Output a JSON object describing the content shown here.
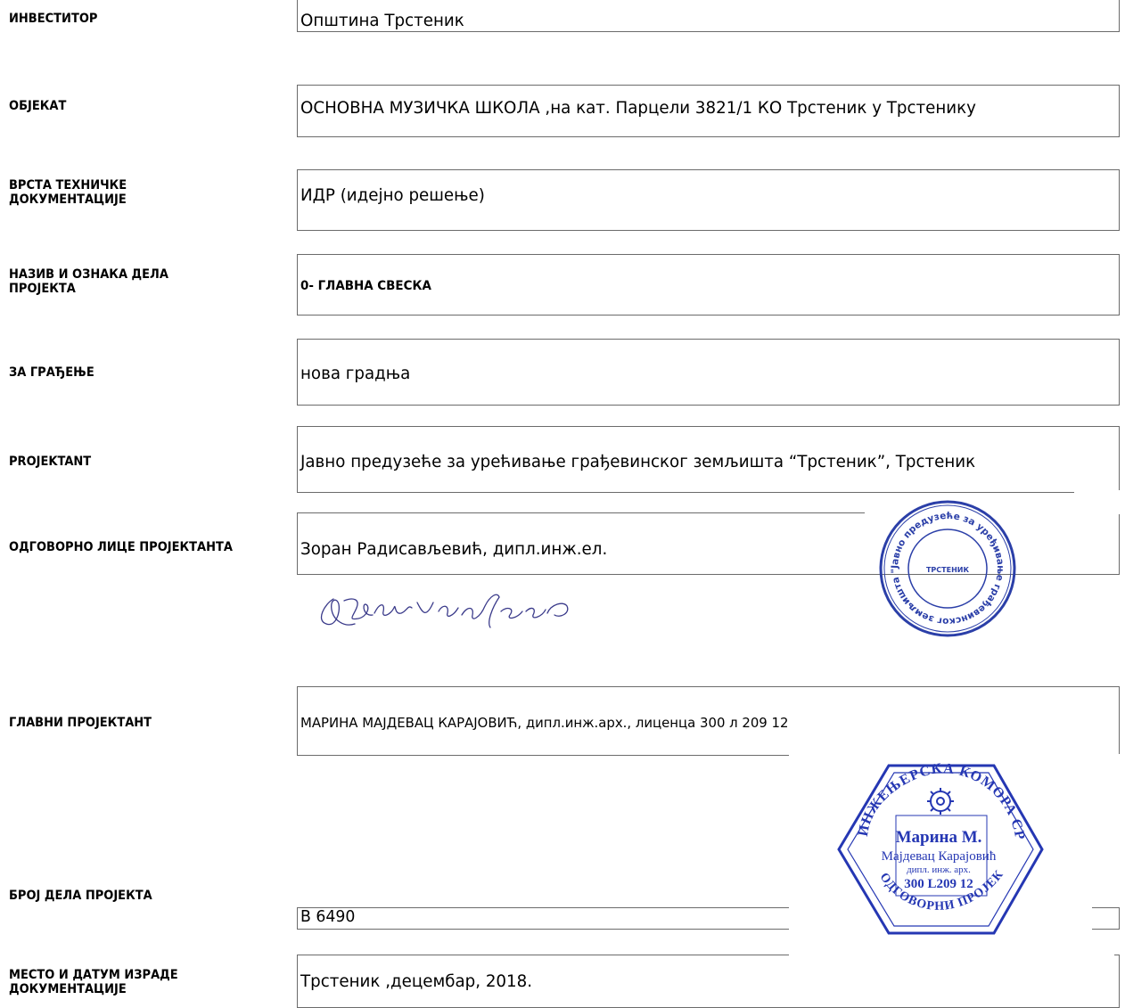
{
  "rows": [
    {
      "label": [
        "ИНВЕСТИТОР"
      ],
      "value": "Општина  Трстеник"
    },
    {
      "label": [
        "ОБЈЕКАТ"
      ],
      "value": "ОСНОВНА МУЗИЧКА ШКОЛА ,на кат. Парцели 3821/1 КО Трстеник у Трстенику"
    },
    {
      "label": [
        "ВРСТА ТЕХНИЧКЕ",
        "ДОКУМЕНТАЦИЈЕ"
      ],
      "value": "ИДР (идејно решење)"
    },
    {
      "label": [
        "НАЗИВ И ОЗНАКА ДЕЛА",
        "ПРОЈЕКТА"
      ],
      "value": "0- ГЛАВНА СВЕСКА"
    },
    {
      "label": [
        "ЗА ГРАЂЕЊЕ"
      ],
      "value": "нова градња"
    },
    {
      "label": [
        "PROJEKTANT"
      ],
      "value": "Јавно предузеће за урећивање грађевинског земљишта “Трстеник”, Трстеник"
    },
    {
      "label": [
        "ОДГОВОРНО ЛИЦЕ ПРОЈЕКТАНТА"
      ],
      "value": "Зоран Радисављевић, дипл.инж.ел."
    },
    {
      "label": [
        "ГЛАВНИ ПРОЈЕКТАНТ"
      ],
      "value": "МАРИНА МАЈДЕВАЦ КАРАЈОВИЋ, дипл.инж.арх.,  лиценца 300 л 209 12"
    },
    {
      "label": [
        "БРОЈ ДЕЛА ПРОЈЕКТА"
      ],
      "value": "B 6490"
    },
    {
      "label": [
        "МЕСТО И ДАТУМ ИЗРАДЕ",
        "ДОКУМЕНТАЦИЈЕ"
      ],
      "value": "Трстеник ,децембар, 2018."
    }
  ],
  "stamp_company": {
    "ring_text": "Јавно предузеће за уређивање грађевинског земљишта \"Трстеник\"",
    "center_text": "ТРСТЕНИК",
    "color": "#2b3fa8"
  },
  "stamp_engineer": {
    "ring_text": "ИНЖЕЊЕРСКА КОМОРА СРБИЈЕ",
    "bottom_text": "ОДГОВОРНИ ПРОЈЕКТАНТ",
    "lines": [
      "Марина М.",
      "Мајдевац Карајовић",
      "дипл. инж. арх.",
      "300 L209 12"
    ],
    "color": "#2537b3"
  },
  "signature": {
    "color": "#3a3a8a"
  }
}
